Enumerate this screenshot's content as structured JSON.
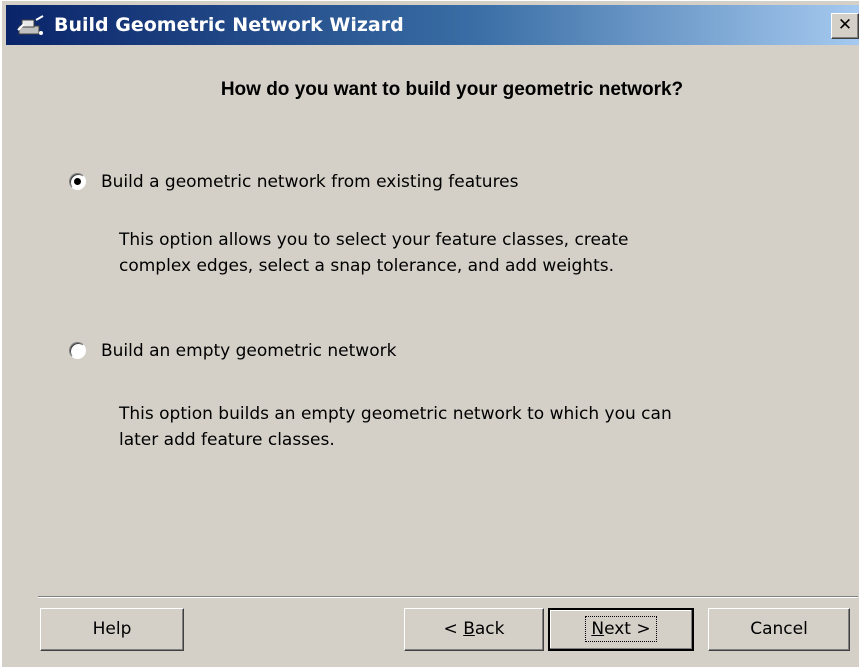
{
  "window": {
    "title": "Build Geometric Network Wizard",
    "close_glyph": "✕",
    "icon": "network-wizard-icon"
  },
  "heading": "How do you want to build your geometric network?",
  "options": [
    {
      "label": "Build a geometric network from existing features",
      "description_line1": "This option allows you to select your feature classes, create",
      "description_line2": "complex edges, select a snap tolerance, and add weights.",
      "selected": true
    },
    {
      "label": "Build an empty geometric network",
      "description_line1": "This option builds an empty geometric network to which you can",
      "description_line2": "later add feature classes.",
      "selected": false
    }
  ],
  "buttons": {
    "help": "Help",
    "back_prefix": "< ",
    "back_mnemonic": "B",
    "back_rest": "ack",
    "next_mnemonic": "N",
    "next_rest": "ext >",
    "cancel": "Cancel"
  },
  "colors": {
    "titlebar_start": "#0a246a",
    "titlebar_end": "#a6caf0",
    "dialog_bg": "#d4d0c8"
  }
}
